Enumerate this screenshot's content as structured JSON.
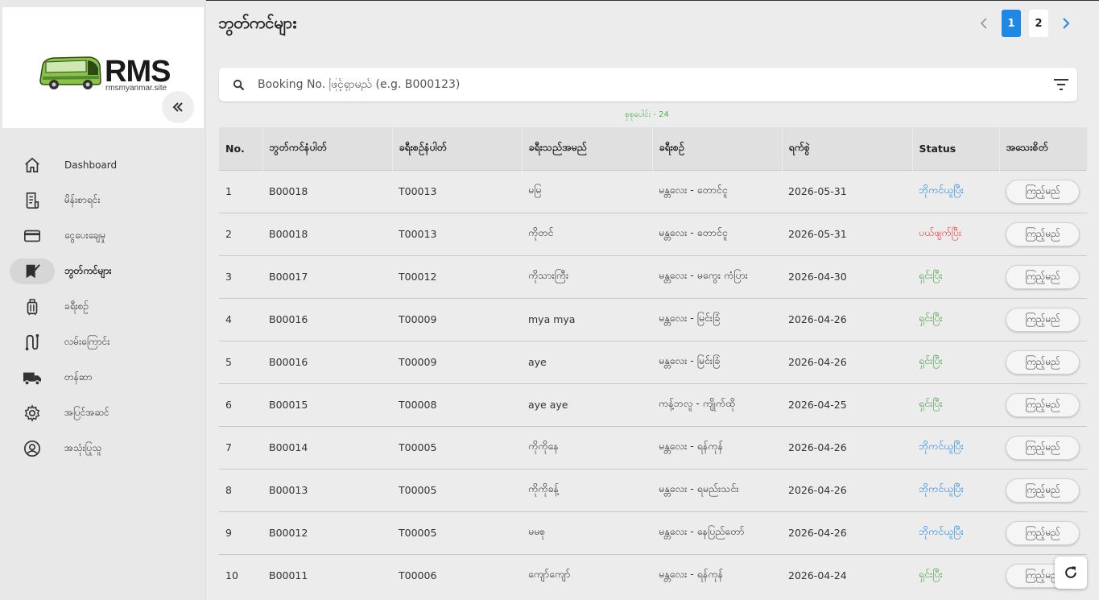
{
  "brand": {
    "name": "RMS",
    "site": "rmsmyanmar.site",
    "accent": "#1e88e5"
  },
  "sidebar": {
    "items": [
      {
        "label": "Dashboard",
        "icon": "home-icon"
      },
      {
        "label": "မိန်းစာရင်း",
        "icon": "receipt-icon"
      },
      {
        "label": "ငွေပေးချေမှု",
        "icon": "credit-card-icon"
      },
      {
        "label": "ဘွတ်ကင်များ",
        "icon": "booking-icon",
        "active": true
      },
      {
        "label": "ခရီးစဉ်",
        "icon": "luggage-icon"
      },
      {
        "label": "လမ်းကြောင်း",
        "icon": "route-icon"
      },
      {
        "label": "တန်ဆာ",
        "icon": "truck-icon"
      },
      {
        "label": "အပြင်အဆင်",
        "icon": "gear-icon"
      },
      {
        "label": "အသုံးပြုသူ",
        "icon": "user-circle-icon"
      }
    ]
  },
  "header": {
    "title": "ဘွတ်ကင်များ"
  },
  "pager": {
    "pages": [
      "1",
      "2"
    ],
    "current": "1"
  },
  "search": {
    "placeholder": "Booking No. ဖြင့်ရှာမည် (e.g. B000123)"
  },
  "total_label": "စုစုပေါင်း - 24",
  "table": {
    "columns": [
      "No.",
      "ဘွတ်ကင်နံပါတ်",
      "ခရီးစဉ်နံပါတ်",
      "ခရီးသည်အမည်",
      "ခရီးစဉ်",
      "ရက်စွဲ",
      "Status",
      "အသေးစိတ်"
    ],
    "view_label": "ကြည့်မည်",
    "rows": [
      {
        "no": "1",
        "booking": "B00018",
        "trip": "T00013",
        "name": "မမြ",
        "route": "မန္တလေး - တောင်ငူ",
        "date": "2026-05-31",
        "status": "ဘိုကင်ယူပြီး",
        "status_color": "blue"
      },
      {
        "no": "2",
        "booking": "B00018",
        "trip": "T00013",
        "name": "ကိုတင်",
        "route": "မန္တလေး - တောင်ငူ",
        "date": "2026-05-31",
        "status": "ပယ်ဖျက်ပြီး",
        "status_color": "red"
      },
      {
        "no": "3",
        "booking": "B00017",
        "trip": "T00012",
        "name": "ကိုသားကြီး",
        "route": "မန္တလေး - မကွေး ကံပြား",
        "date": "2026-04-30",
        "status": "ရှင်းပြီး",
        "status_color": "green"
      },
      {
        "no": "4",
        "booking": "B00016",
        "trip": "T00009",
        "name": "mya mya",
        "route": "မန္တလေး - မြင်းခြံ",
        "date": "2026-04-26",
        "status": "ရှင်းပြီး",
        "status_color": "green"
      },
      {
        "no": "5",
        "booking": "B00016",
        "trip": "T00009",
        "name": "aye",
        "route": "မန္တလေး - မြင်းခြံ",
        "date": "2026-04-26",
        "status": "ရှင်းပြီး",
        "status_color": "green"
      },
      {
        "no": "6",
        "booking": "B00015",
        "trip": "T00008",
        "name": "aye aye",
        "route": "ကန့်ဘလူ - ကျိုက်ထို",
        "date": "2026-04-25",
        "status": "ရှင်းပြီး",
        "status_color": "green"
      },
      {
        "no": "7",
        "booking": "B00014",
        "trip": "T00005",
        "name": "ကိုကိုနေ",
        "route": "မန္တလေး - ရန်ကုန်",
        "date": "2026-04-26",
        "status": "ဘိုကင်ယူပြီး",
        "status_color": "blue"
      },
      {
        "no": "8",
        "booking": "B00013",
        "trip": "T00005",
        "name": "ကိုကိုခန့်",
        "route": "မန္တလေး - ရမည်းသင်း",
        "date": "2026-04-26",
        "status": "ဘိုကင်ယူပြီး",
        "status_color": "blue"
      },
      {
        "no": "9",
        "booking": "B00012",
        "trip": "T00005",
        "name": "မမစု",
        "route": "မန္တလေး - နေပြည်တော်",
        "date": "2026-04-26",
        "status": "ဘိုကင်ယူပြီး",
        "status_color": "blue"
      },
      {
        "no": "10",
        "booking": "B00011",
        "trip": "T00006",
        "name": "ကျော်ကျော်",
        "route": "မန္တလေး - ရန်ကုန်",
        "date": "2026-04-24",
        "status": "ရှင်းပြီး",
        "status_color": "green"
      }
    ]
  }
}
